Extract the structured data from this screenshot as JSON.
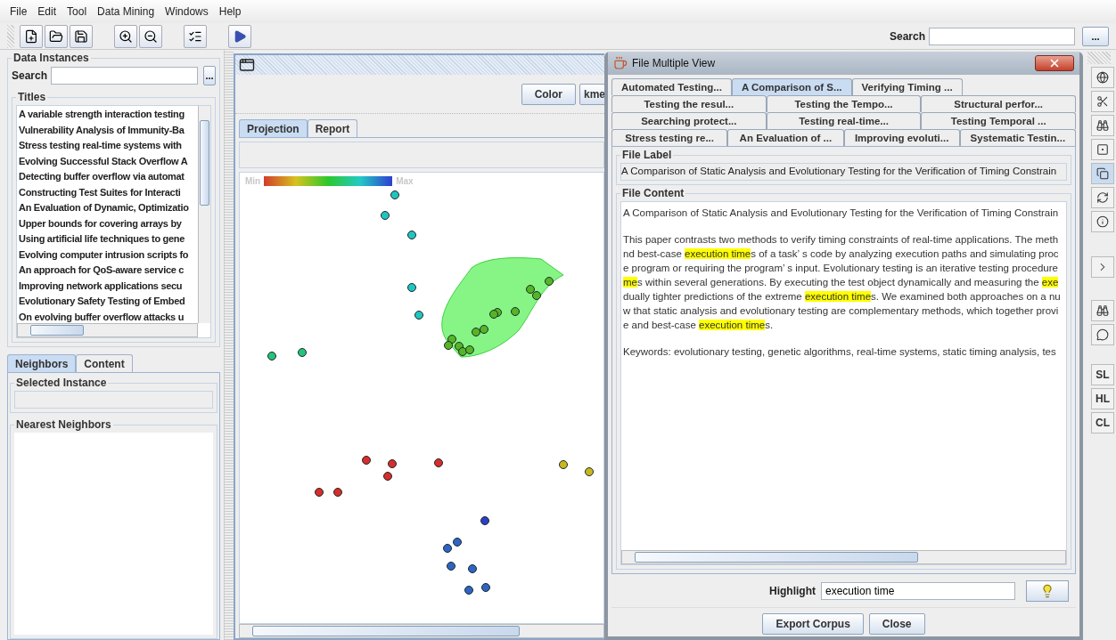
{
  "menu": [
    "File",
    "Edit",
    "Tool",
    "Data Mining",
    "Windows",
    "Help"
  ],
  "toolbar": {
    "search_label": "Search",
    "search_button": "..."
  },
  "data_instances": {
    "title": "Data Instances",
    "search_label": "Search",
    "search_button": "...",
    "titles_label": "Titles",
    "titles": [
      "A variable strength interaction testing",
      "Vulnerability Analysis of Immunity-Ba",
      "Stress testing real-time systems with",
      "Evolving Successful Stack Overflow A",
      "Detecting buffer overflow via automat",
      "Constructing Test Suites for Interacti",
      "An Evaluation of Dynamic, Optimizatio",
      "Upper bounds for covering arrays by",
      "Using artificial life techniques to gene",
      "Evolving computer intrusion scripts fo",
      "An approach for QoS-aware service c",
      "Improving network applications secu",
      "Evolutionary Safety Testing of Embed",
      "On evolving buffer overflow attacks u"
    ]
  },
  "lower_tabs": [
    {
      "label": "Neighbors",
      "selected": true
    },
    {
      "label": "Content",
      "selected": false
    }
  ],
  "selected_instance": {
    "title": "Selected Instance"
  },
  "nearest_neighbors": {
    "title": "Nearest Neighbors"
  },
  "projection_window": {
    "buttons": [
      "Color",
      "kme"
    ],
    "tabs": [
      {
        "label": "Projection",
        "selected": true
      },
      {
        "label": "Report",
        "selected": false
      }
    ],
    "legend": {
      "min": "Min",
      "max": "Max"
    }
  },
  "dialog": {
    "title": "File Multiple View",
    "tab_rows": [
      [
        {
          "label": "Automated Testing...",
          "selected": false
        },
        {
          "label": "A Comparison of S...",
          "selected": true
        },
        {
          "label": "Verifying Timing ...",
          "selected": false
        }
      ],
      [
        {
          "label": "Testing the resul...",
          "selected": false
        },
        {
          "label": "Testing the Tempo...",
          "selected": false
        },
        {
          "label": "Structural perfor...",
          "selected": false
        }
      ],
      [
        {
          "label": "Searching protect...",
          "selected": false
        },
        {
          "label": "Testing real-time...",
          "selected": false
        },
        {
          "label": "Testing Temporal ...",
          "selected": false
        }
      ],
      [
        {
          "label": "Stress testing re...",
          "selected": false
        },
        {
          "label": "An Evaluation of ...",
          "selected": false
        },
        {
          "label": "Improving evoluti...",
          "selected": false
        },
        {
          "label": "Systematic Testin...",
          "selected": false
        }
      ]
    ],
    "file_label": {
      "title": "File Label",
      "value": "A Comparison of Static Analysis and Evolutionary Testing for the Verification of Timing Constrain"
    },
    "file_content": {
      "title": "File Content",
      "paragraphs": [
        [
          [
            {
              "text": "A Comparison of Static Analysis and Evolutionary Testing for the Verification of Timing Constrain",
              "highlighted": false
            }
          ]
        ],
        [
          [
            {
              "text": "This paper contrasts two methods to verify timing constraints of real-time applications. The meth",
              "highlighted": false
            }
          ],
          [
            {
              "text": "nd best-case ",
              "highlighted": false
            },
            {
              "text": "execution time",
              "highlighted": true
            },
            {
              "text": "s of a task’ s code by analyzing execution paths and simulating proc",
              "highlighted": false
            }
          ],
          [
            {
              "text": "e program or requiring the program’ s input. Evolutionary testing is an iterative testing procedure",
              "highlighted": false
            }
          ],
          [
            {
              "text": "me",
              "highlighted": true
            },
            {
              "text": "s within several generations. By executing the test object dynamically and measuring the ",
              "highlighted": false
            },
            {
              "text": "exe",
              "highlighted": true
            }
          ],
          [
            {
              "text": "dually tighter predictions of the extreme ",
              "highlighted": false
            },
            {
              "text": "execution time",
              "highlighted": true
            },
            {
              "text": "s. We examined both approaches on a nu",
              "highlighted": false
            }
          ],
          [
            {
              "text": "w that static analysis and evolutionary testing are complementary methods, which together provi",
              "highlighted": false
            }
          ],
          [
            {
              "text": "e and best-case ",
              "highlighted": false
            },
            {
              "text": "execution time",
              "highlighted": true
            },
            {
              "text": "s.",
              "highlighted": false
            }
          ]
        ],
        [
          [
            {
              "text": "Keywords: evolutionary testing, genetic algorithms, real-time systems, static timing analysis, tes",
              "highlighted": false
            }
          ]
        ]
      ]
    },
    "highlight": {
      "label": "Highlight",
      "value": "execution time"
    },
    "buttons": [
      "Export Corpus",
      "Close"
    ]
  },
  "right_toolbar": {
    "icon_buttons": [
      {
        "selected": false
      },
      {
        "selected": false
      },
      {
        "selected": false
      },
      {
        "selected": false
      },
      {
        "selected": true
      },
      {
        "selected": false
      },
      {
        "selected": false
      },
      {
        "selected": false
      },
      {
        "selected": false
      },
      {
        "selected": false
      }
    ],
    "text_buttons": [
      "SL",
      "HL",
      "CL"
    ]
  }
}
